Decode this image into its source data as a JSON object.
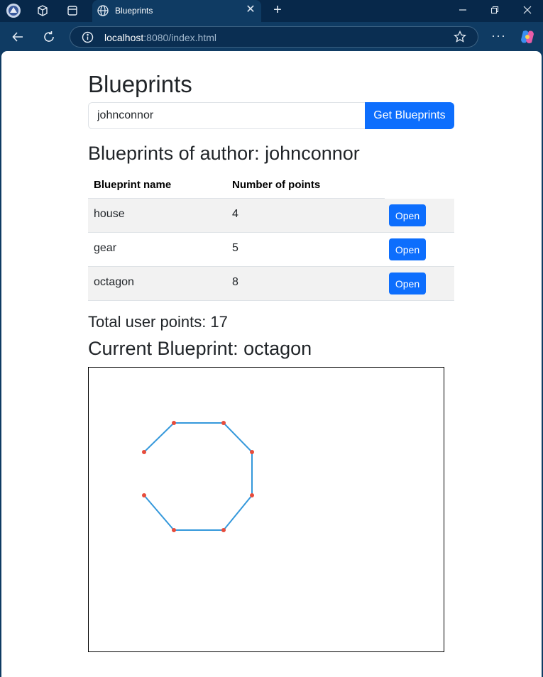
{
  "browser": {
    "tab_title": "Blueprints",
    "url_host": "localhost",
    "url_path": ":8080/index.html",
    "more_label": "···"
  },
  "page": {
    "title": "Blueprints",
    "author_input_value": "johnconnor",
    "get_button_label": "Get Blueprints",
    "author_heading": "Blueprints of author: johnconnor",
    "table": {
      "headers": [
        "Blueprint name",
        "Number of points"
      ],
      "open_label": "Open",
      "rows": [
        {
          "name": "house",
          "points": "4"
        },
        {
          "name": "gear",
          "points": "5"
        },
        {
          "name": "octagon",
          "points": "8"
        }
      ]
    },
    "total_points": "Total user points: 17",
    "current_blueprint": "Current Blueprint: octagon"
  },
  "drawing": {
    "line_color": "#3498db",
    "point_color": "#e74c3c"
  },
  "colors": {
    "primary_button": "#0d6efd",
    "browser_bg": "#0f3b63",
    "tabbar_bg": "#07284a"
  }
}
